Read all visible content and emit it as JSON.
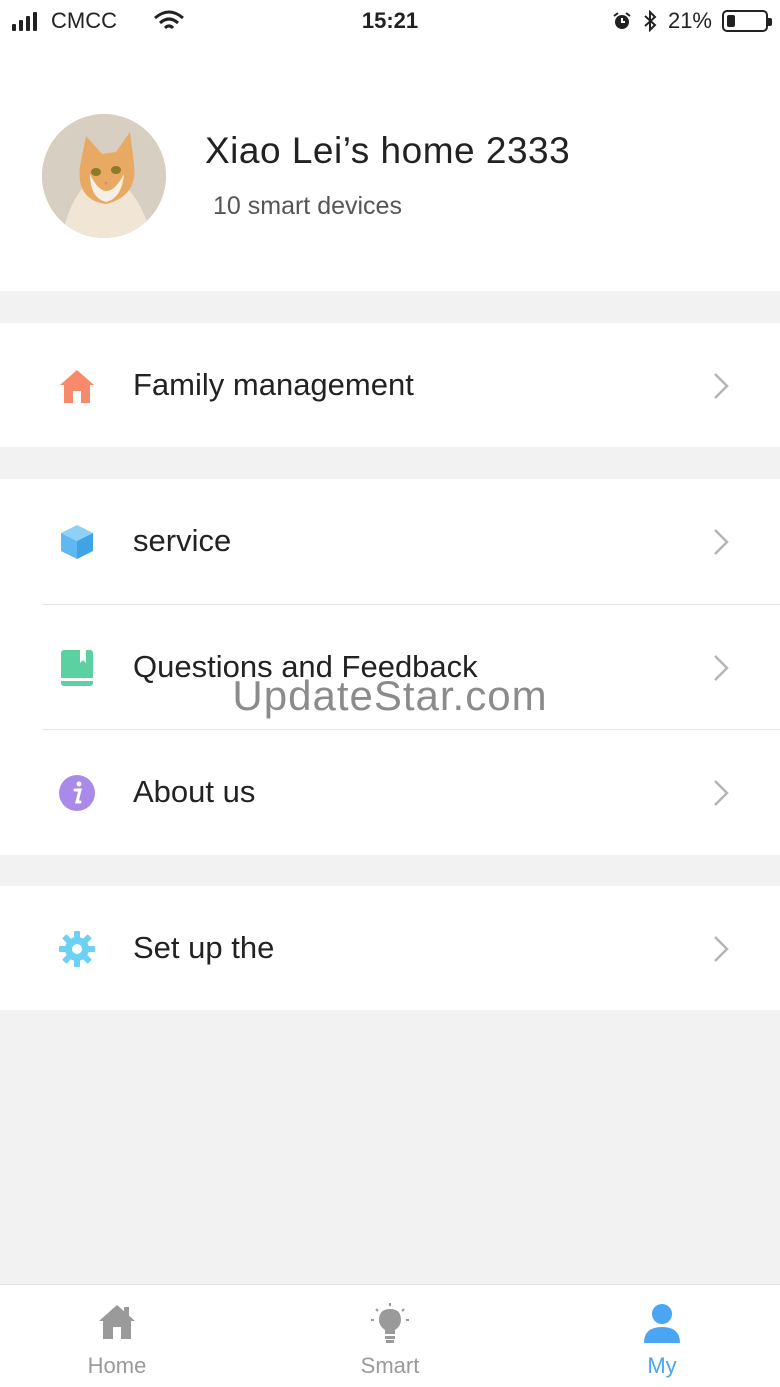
{
  "status_bar": {
    "carrier": "CMCC",
    "time": "15:21",
    "battery_percent": "21%",
    "battery_level": 0.21
  },
  "profile": {
    "home_name": "Xiao Lei’s home 2333",
    "device_count": "10 smart devices"
  },
  "menu": {
    "family": {
      "label": "Family management",
      "icon": "house-icon",
      "color": "#f68a6b"
    },
    "service": {
      "label": "service",
      "icon": "cube-icon",
      "color": "#5fb8f0"
    },
    "feedback": {
      "label": "Questions and Feedback",
      "icon": "book-icon",
      "color": "#5bd0a0"
    },
    "about": {
      "label": "About us",
      "icon": "info-icon",
      "color": "#a98ae8"
    },
    "setup": {
      "label": "Set up the",
      "icon": "gear-icon",
      "color": "#6cd1f3"
    }
  },
  "watermark": "UpdateStar.com",
  "tabs": [
    {
      "label": "Home",
      "icon": "home-icon",
      "active": false
    },
    {
      "label": "Smart",
      "icon": "lightbulb-icon",
      "active": false
    },
    {
      "label": "My",
      "icon": "user-icon",
      "active": true
    }
  ],
  "colors": {
    "accent": "#4aa6f2",
    "inactive": "#9a9a9a",
    "background": "#f2f2f2"
  }
}
